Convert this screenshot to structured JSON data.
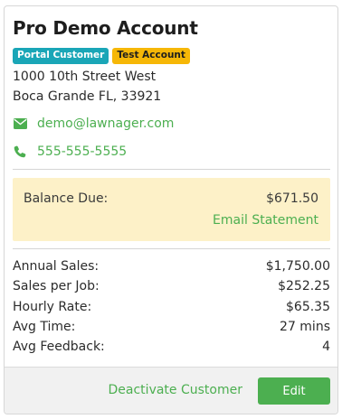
{
  "account": {
    "name": "Pro Demo Account",
    "badges": [
      "Portal Customer",
      "Test Account"
    ],
    "address_line1": "1000 10th Street West",
    "address_line2": "Boca Grande FL, 33921",
    "email": "demo@lawnager.com",
    "phone": "555-555-5555"
  },
  "balance": {
    "label": "Balance Due:",
    "value": "$671.50",
    "action": "Email Statement"
  },
  "stats": [
    {
      "label": "Annual Sales:",
      "value": "$1,750.00"
    },
    {
      "label": "Sales per Job:",
      "value": "$252.25"
    },
    {
      "label": "Hourly Rate:",
      "value": "$65.35"
    },
    {
      "label": "Avg Time:",
      "value": "27 mins"
    },
    {
      "label": "Avg Feedback:",
      "value": "4"
    }
  ],
  "footer": {
    "deactivate_label": "Deactivate Customer",
    "edit_label": "Edit"
  },
  "colors": {
    "accent": "#4caf50",
    "badge_portal": "#1aa6b7",
    "badge_test": "#f6b707",
    "balance_bg": "#fdf1c8"
  },
  "icons": {
    "email": "envelope-icon",
    "phone": "phone-icon"
  }
}
